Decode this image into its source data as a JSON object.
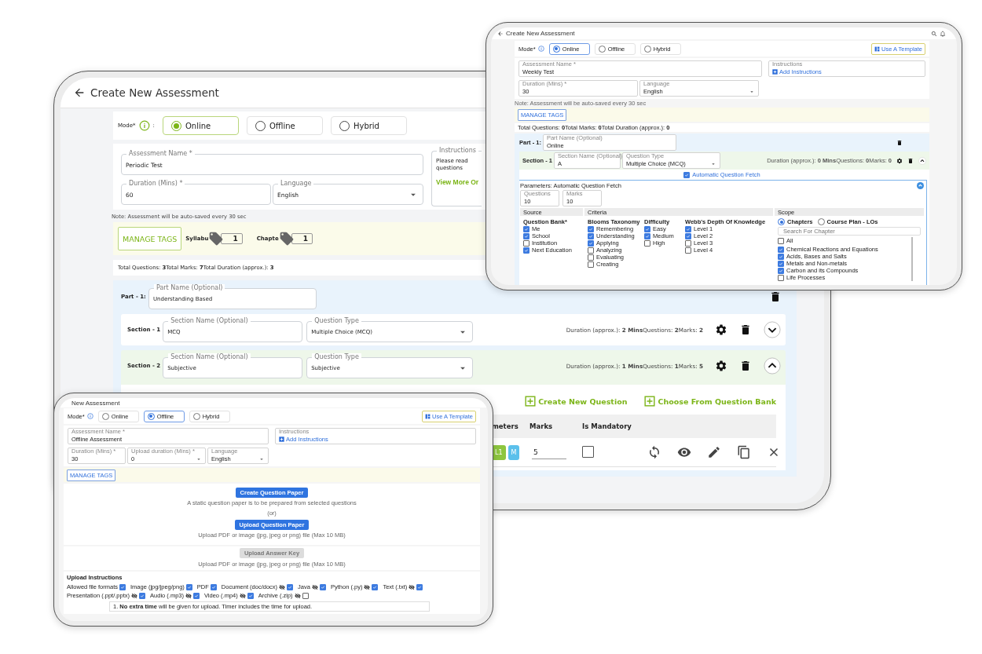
{
  "main": {
    "title": "Create New Assessment",
    "mode_label": "Mode*",
    "mode_colon": ":",
    "modes": [
      {
        "label": "Online",
        "selected": true
      },
      {
        "label": "Offline",
        "selected": false
      },
      {
        "label": "Hybrid",
        "selected": false
      }
    ],
    "name_field": {
      "label": "Assessment Name *",
      "value": "Periodic Test"
    },
    "duration_field": {
      "label": "Duration (Mins) *",
      "value": "60"
    },
    "language_field": {
      "label": "Language",
      "value": "English"
    },
    "instructions": {
      "label": "Instructions",
      "text": "Please read questions",
      "link": "View More Or"
    },
    "note": "Note: Assessment will be auto-saved every 30 sec",
    "manage_tags": "MANAGE TAGS",
    "tags": [
      {
        "label": "Syllabu",
        "count": "1"
      },
      {
        "label": "Chapte",
        "count": "1"
      }
    ],
    "totals": "Total Questions: **3**Total Marks: **7**Total Duration (approx.): **3**",
    "part": {
      "label": "Part - 1:",
      "name_label": "Part Name (Optional)",
      "name_value": "Understanding Based"
    },
    "sections": [
      {
        "label": "Section - 1",
        "name_label": "Section Name (Optional)",
        "name_value": "MCQ",
        "type_label": "Question Type",
        "type_value": "Multiple Choice (MCQ)",
        "stats": "Duration (approx.): **2 Mins**Questions: **2**Marks: **2**",
        "expanded": false
      },
      {
        "label": "Section - 2",
        "name_label": "Section Name (Optional)",
        "name_value": "Subjective",
        "type_label": "Question Type",
        "type_value": "Subjective",
        "stats": "Duration (approx.): **1 Mins**Questions: **1**Marks: **5**",
        "expanded": true
      }
    ],
    "actions": [
      "Create New Question",
      "Choose From Question Bank"
    ],
    "table": {
      "columns": [
        "meters",
        "Marks",
        "Is Mandatory"
      ],
      "rows": [
        {
          "chips": [
            {
              "label": "L1",
              "color": "#8dc63f"
            },
            {
              "label": "M",
              "color": "#5bc0eb"
            }
          ],
          "marks": "5",
          "mandatory": false
        }
      ]
    }
  },
  "online": {
    "title": "Create New Assessment",
    "mode_label": "Mode*",
    "modes": [
      {
        "label": "Online",
        "selected": true
      },
      {
        "label": "Offline",
        "selected": false
      },
      {
        "label": "Hybrid",
        "selected": false
      }
    ],
    "template": "Use A Template",
    "name_field": {
      "label": "Assessment Name *",
      "value": "Weekly Test"
    },
    "duration_field": {
      "label": "Duration (Mins) *",
      "value": "30"
    },
    "language_field": {
      "label": "Language",
      "value": "English"
    },
    "instructions": {
      "label": "Instructions",
      "link": "Add Instructions"
    },
    "note": "Note: Assessment will be auto-saved every 30 sec",
    "manage_tags": "MANAGE TAGS",
    "totals": "Total Questions: **0**Total Marks: **0**Total Duration (approx.): **0**",
    "part": {
      "label": "Part - 1:",
      "name_label": "Part Name (Optional)",
      "name_value": "Online"
    },
    "section": {
      "label": "Section - 1",
      "name_label": "Section Name (Optional)",
      "name_value": "A",
      "type_label": "Question Type",
      "type_value": "Multiple Choice (MCQ)",
      "stats": "Duration (approx.): **0 Mins**Questions: **0**Marks: **0**",
      "expanded": true
    },
    "auto_fetch": {
      "label": "Automatic Question Fetch",
      "checked": true
    },
    "params": {
      "title": "Parameters: Automatic Question Fetch",
      "questions": {
        "label": "Questions",
        "value": "10"
      },
      "marks": {
        "label": "Marks",
        "value": "10"
      },
      "source": {
        "heading": "Source",
        "group": "Question Bank*",
        "items": [
          {
            "label": "Me",
            "checked": true
          },
          {
            "label": "School",
            "checked": true
          },
          {
            "label": "Institution",
            "checked": false
          },
          {
            "label": "Next Education",
            "checked": true
          }
        ]
      },
      "criteria": {
        "heading": "Criteria",
        "groups": [
          {
            "title": "Blooms Taxonomy",
            "items": [
              {
                "label": "Remembering",
                "checked": true
              },
              {
                "label": "Understanding",
                "checked": true
              },
              {
                "label": "Applying",
                "checked": true
              },
              {
                "label": "Analyzing",
                "checked": false
              },
              {
                "label": "Evaluating",
                "checked": false
              },
              {
                "label": "Creating",
                "checked": false
              }
            ]
          },
          {
            "title": "Difficulty",
            "items": [
              {
                "label": "Easy",
                "checked": true
              },
              {
                "label": "Medium",
                "checked": true
              },
              {
                "label": "High",
                "checked": false
              }
            ]
          },
          {
            "title": "Webb's Depth Of Knowledge",
            "items": [
              {
                "label": "Level 1",
                "checked": true
              },
              {
                "label": "Level 2",
                "checked": true
              },
              {
                "label": "Level 3",
                "checked": false
              },
              {
                "label": "Level 4",
                "checked": false
              }
            ]
          }
        ]
      },
      "scope": {
        "heading": "Scope",
        "options": [
          {
            "label": "Chapters",
            "selected": true
          },
          {
            "label": "Course Plan - LOs",
            "selected": false
          }
        ],
        "search_placeholder": "Search For Chapter",
        "items": [
          {
            "label": "All",
            "checked": false
          },
          {
            "label": "Chemical Reactions and Equations",
            "checked": true
          },
          {
            "label": "Acids, Bases and Salts",
            "checked": true
          },
          {
            "label": "Metals and Non-metals",
            "checked": true
          },
          {
            "label": "Carbon and its Compounds",
            "checked": true
          },
          {
            "label": "Life Processes",
            "checked": false
          }
        ]
      }
    }
  },
  "offline": {
    "title": "New Assessment",
    "mode_label": "Mode*",
    "modes": [
      {
        "label": "Online",
        "selected": false
      },
      {
        "label": "Offline",
        "selected": true
      },
      {
        "label": "Hybrid",
        "selected": false
      }
    ],
    "template": "Use A Template",
    "name_field": {
      "label": "Assessment Name *",
      "value": "Offline Assessment"
    },
    "duration_field": {
      "label": "Duration (Mins) *",
      "value": "30"
    },
    "upload_field": {
      "label": "Upload duration (Mins) *",
      "value": "0"
    },
    "language_field": {
      "label": "Language",
      "value": "English"
    },
    "instructions": {
      "label": "Instructions",
      "link": "Add Instructions"
    },
    "manage_tags": "MANAGE TAGS",
    "create_button": "Create Question Paper",
    "create_hint": "A static question paper is to be prepared from selected questions",
    "or": "(or)",
    "upload_button": "Upload Question Paper",
    "upload_hint": "Upload PDF or image (jpg, jpeg or png) file (Max 10 MB)",
    "answer_button": {
      "label": "Upload Answer Key",
      "disabled": true
    },
    "answer_hint": "Upload PDF or image (jpg, jpeg or png) file (Max 10 MB)",
    "upload_instructions": "Upload Instructions",
    "formats": [
      {
        "label": "Allowed file formats",
        "restricted": false,
        "checked": true
      },
      {
        "label": "Image (jpg/jpeg/png)",
        "restricted": false,
        "checked": true
      },
      {
        "label": "PDF",
        "restricted": false,
        "checked": true
      },
      {
        "label": "Document (doc/docx)",
        "restricted": true,
        "checked": true
      },
      {
        "label": "Java",
        "restricted": true,
        "checked": true
      },
      {
        "label": "Python (.py)",
        "restricted": true,
        "checked": true
      },
      {
        "label": "Text (.txt)",
        "restricted": true,
        "checked": true
      },
      {
        "label": "Presentation (.ppt/.pptx)",
        "restricted": true,
        "checked": true
      },
      {
        "label": "Audio (.mp3)",
        "restricted": true,
        "checked": true
      },
      {
        "label": "Video (.mp4)",
        "restricted": true,
        "checked": true
      },
      {
        "label": "Archive (.zip)",
        "restricted": true,
        "checked": false
      }
    ],
    "instruction_text": "1. **No extra time** will be given for upload. Timer includes the time for upload."
  }
}
